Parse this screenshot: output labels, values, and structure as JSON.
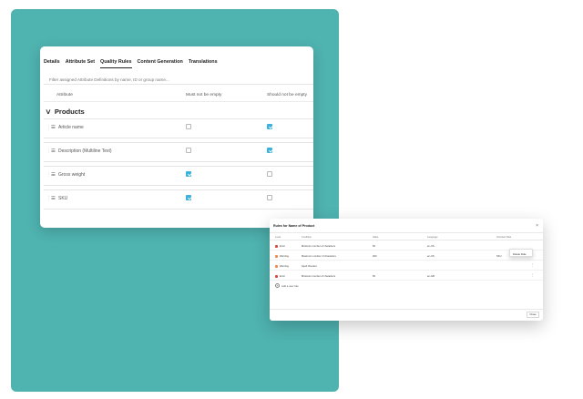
{
  "tabs": [
    "Details",
    "Attribute Set",
    "Quality Rules",
    "Content Generation",
    "Translations"
  ],
  "active_tab": "Quality Rules",
  "filter": {
    "placeholder": "Filter assigned Attribute Definitions by name, ID or group name..."
  },
  "columns": {
    "attribute": "Attribute",
    "not_empty": "Must not be empty",
    "should_not_empty": "Should not be empty"
  },
  "group": {
    "label": "Products"
  },
  "rows": [
    {
      "name": "Article name",
      "must_not_be_empty": false,
      "should_not_be_empty": true
    },
    {
      "name": "Description (Multiline Text)",
      "must_not_be_empty": false,
      "should_not_be_empty": true
    },
    {
      "name": "Gross weight",
      "must_not_be_empty": true,
      "should_not_be_empty": false
    },
    {
      "name": "SKU",
      "must_not_be_empty": true,
      "should_not_be_empty": false
    }
  ],
  "dialog": {
    "title": "Rules for Name of Product",
    "close_label": "Close",
    "add_label": "Add a new rule",
    "menu_item": "Delete Rule",
    "headers": {
      "level": "Level",
      "condition": "Condition",
      "value": "Value",
      "language": "Language",
      "inherited": "Inherited Rule"
    },
    "rules": [
      {
        "level": "Error",
        "level_color": "#e0483e",
        "condition": "Minimum number of characters",
        "value": "50",
        "language": "en-US",
        "inherited": ""
      },
      {
        "level": "Warning",
        "level_color": "#f08a4b",
        "condition": "Maximum number of characters",
        "value": "200",
        "language": "en-US",
        "inherited": "SKU"
      },
      {
        "level": "Warning",
        "level_color": "#f08a4b",
        "condition": "Spell Checker",
        "value": "",
        "language": "",
        "inherited": ""
      },
      {
        "level": "Error",
        "level_color": "#e0483e",
        "condition": "Minimum number of characters",
        "value": "50",
        "language": "en-GB",
        "inherited": ""
      }
    ]
  }
}
